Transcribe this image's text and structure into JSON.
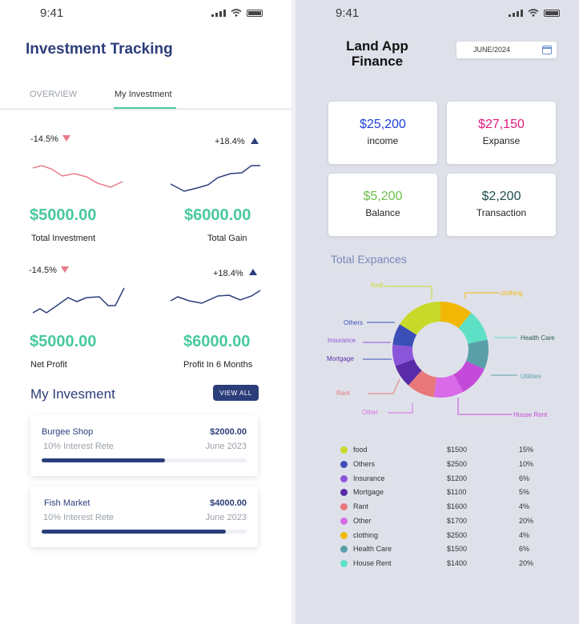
{
  "left": {
    "status_time": "9:41",
    "title": "Investment Tracking",
    "tabs": [
      {
        "label": "OVERVIEW"
      },
      {
        "label": "My Investment"
      }
    ],
    "metrics": [
      {
        "pct": "-14.5%",
        "direction": "down",
        "amount": "$5000.00",
        "label": "Total Investment"
      },
      {
        "pct": "+18.4%",
        "direction": "up",
        "amount": "$6000.00",
        "label": "Total Gain"
      },
      {
        "pct": "-14.5%",
        "direction": "down",
        "amount": "$5000.00",
        "label": "Net Profit"
      },
      {
        "pct": "+18.4%",
        "direction": "up",
        "amount": "$6000.00",
        "label": "Profit In 6 Months"
      }
    ],
    "section_title": "My Invesment",
    "view_all": "VIEW ALL",
    "investments": [
      {
        "name": "Burgee Shop",
        "amount": "$2000.00",
        "rate": "10% Interest Rete",
        "date": "June 2023",
        "progress": 0.6
      },
      {
        "name": "Fish Market",
        "amount": "$4000.00",
        "rate": "10% Interest Rete",
        "date": "June 2023",
        "progress": 0.9
      }
    ]
  },
  "right": {
    "status_time": "9:41",
    "title": "Land App Finance",
    "date_value": "JUNE/2024",
    "stats": [
      {
        "value": "$25,200",
        "label": "income",
        "color": "#1f3fd6"
      },
      {
        "value": "$27,150",
        "label": "Expanse",
        "color": "#e2187a"
      },
      {
        "value": "$5,200",
        "label": "Balance",
        "color": "#6cc04a"
      },
      {
        "value": "$2,200",
        "label": "Transaction",
        "color": "#1e4d4d"
      }
    ],
    "expenses_title": "Total Expances",
    "chart_data": {
      "type": "pie",
      "categories": [
        "food",
        "Others",
        "Insurance",
        "Mortgage",
        "Rant",
        "Other",
        "clothing",
        "Health Care",
        "Utilities",
        "House Rent"
      ],
      "values": [
        15,
        10,
        6,
        5,
        4,
        20,
        4,
        6,
        20
      ],
      "colors": [
        "#c8d92a",
        "#3b4fb8",
        "#8a55d9",
        "#5a2ba8",
        "#e8787a",
        "#d96be8",
        "#f2b705",
        "#5ee0c6",
        "#5a9fa8",
        "#c44ad9"
      ]
    },
    "legend": [
      {
        "name": "food",
        "amount": "$1500",
        "pct": "15%",
        "color": "#c8d92a"
      },
      {
        "name": "Others",
        "amount": "$2500",
        "pct": "10%",
        "color": "#3b4fb8"
      },
      {
        "name": "Insurance",
        "amount": "$1200",
        "pct": "6%",
        "color": "#8a55d9"
      },
      {
        "name": "Mortgage",
        "amount": "$1100",
        "pct": "5%",
        "color": "#5a2ba8"
      },
      {
        "name": "Rant",
        "amount": "$1600",
        "pct": "4%",
        "color": "#e8787a"
      },
      {
        "name": "Other",
        "amount": "$1700",
        "pct": "20%",
        "color": "#d96be8"
      },
      {
        "name": "clothing",
        "amount": "$2500",
        "pct": "4%",
        "color": "#f2b705"
      },
      {
        "name": "Health Care",
        "amount": "$1500",
        "pct": "6%",
        "color": "#5a9fa8"
      },
      {
        "name": "House Rent",
        "amount": "$1400",
        "pct": "20%",
        "color": "#5ee0c6"
      }
    ]
  }
}
